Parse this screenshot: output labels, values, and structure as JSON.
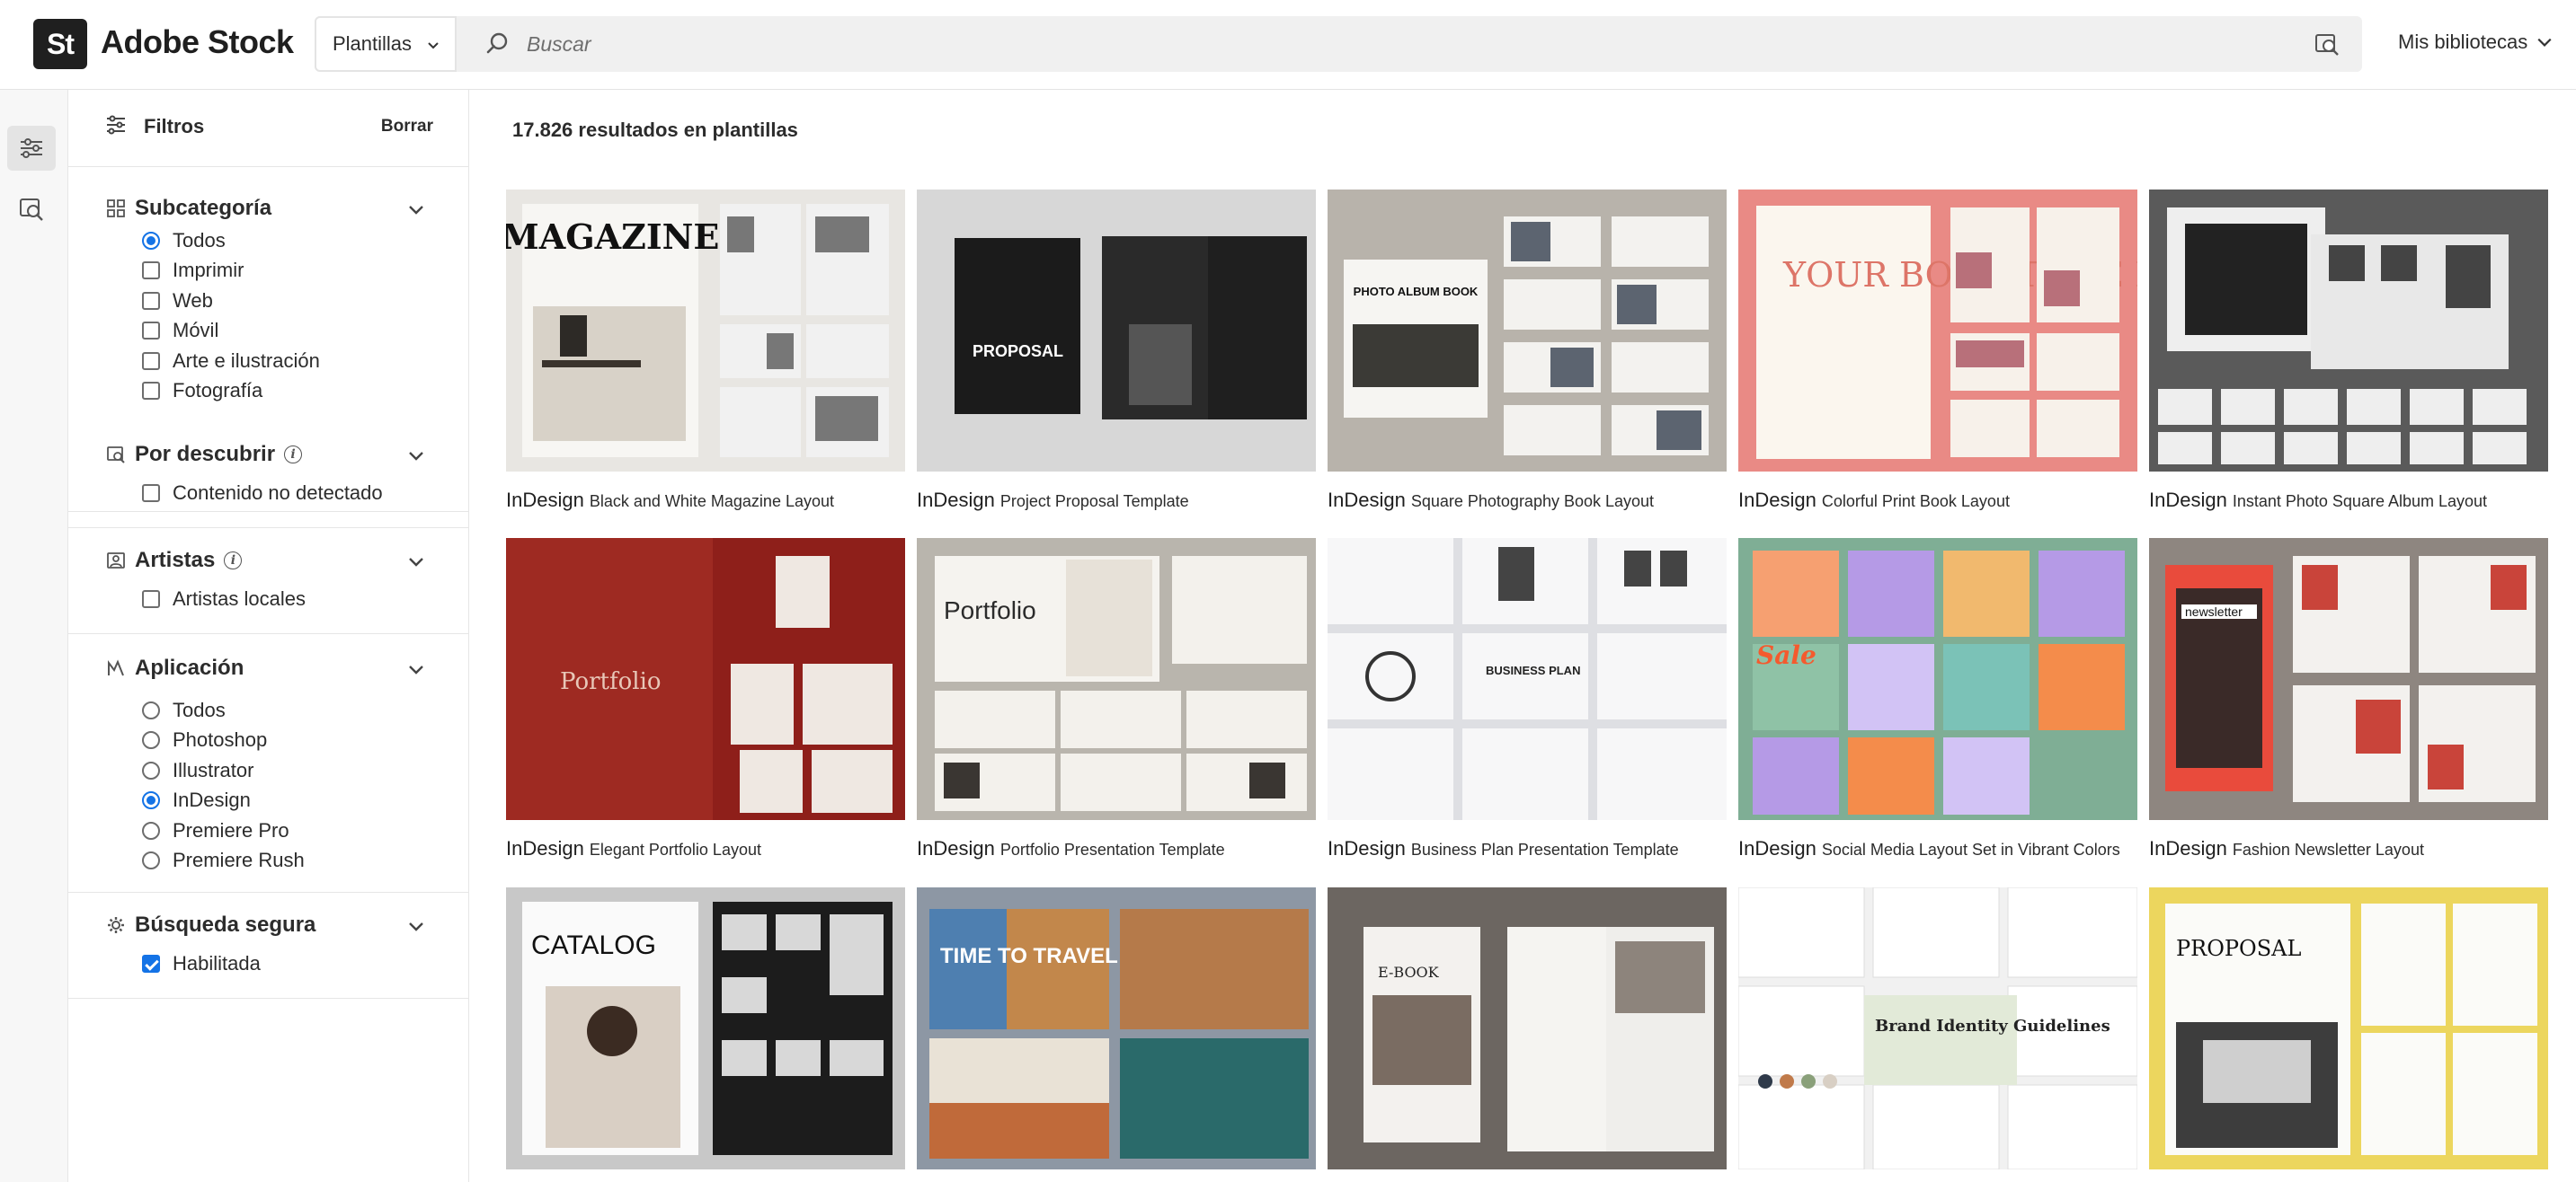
{
  "header": {
    "logo_text": "St",
    "brand": "Adobe Stock",
    "type_select": "Plantillas",
    "search_placeholder": "Buscar",
    "libraries": "Mis bibliotecas"
  },
  "rail": {
    "items": [
      "filters-toggle-icon",
      "visual-search-icon"
    ]
  },
  "filters": {
    "title": "Filtros",
    "clear": "Borrar",
    "sections": [
      {
        "title": "Subcategoría",
        "icon": "grid-icon",
        "info": false,
        "type": "radio",
        "options": [
          {
            "label": "Todos",
            "selected": true
          },
          {
            "label": "Imprimir",
            "selected": false
          },
          {
            "label": "Web",
            "selected": false
          },
          {
            "label": "Móvil",
            "selected": false
          },
          {
            "label": "Arte e ilustración",
            "selected": false
          },
          {
            "label": "Fotografía",
            "selected": false
          }
        ]
      },
      {
        "title": "Por descubrir",
        "icon": "discover-icon",
        "info": true,
        "type": "checkbox",
        "options": [
          {
            "label": "Contenido no detectado",
            "selected": false
          }
        ]
      },
      {
        "title": "Artistas",
        "icon": "artist-icon",
        "info": true,
        "type": "checkbox",
        "options": [
          {
            "label": "Artistas locales",
            "selected": false
          }
        ]
      },
      {
        "title": "Aplicación",
        "icon": "app-icon",
        "info": false,
        "type": "radio",
        "options": [
          {
            "label": "Todos",
            "selected": false
          },
          {
            "label": "Photoshop",
            "selected": false
          },
          {
            "label": "Illustrator",
            "selected": false
          },
          {
            "label": "InDesign",
            "selected": true
          },
          {
            "label": "Premiere Pro",
            "selected": false
          },
          {
            "label": "Premiere Rush",
            "selected": false
          }
        ]
      },
      {
        "title": "Búsqueda segura",
        "icon": "gear-icon",
        "info": false,
        "type": "checkbox",
        "options": [
          {
            "label": "Habilitada",
            "selected": true
          }
        ]
      }
    ]
  },
  "main": {
    "results": "17.826 resultados en plantillas",
    "cards": [
      {
        "app": "InDesign",
        "title": "Black and White Magazine Layout",
        "thumb_text": "MAGAZINE",
        "bg": "#e8e6e2"
      },
      {
        "app": "InDesign",
        "title": "Project Proposal Template",
        "thumb_text": "PROPOSAL",
        "bg": "#d7d7d7"
      },
      {
        "app": "InDesign",
        "title": "Square Photography Book Layout",
        "thumb_text": "PHOTO ALBUM BOOK",
        "bg": "#b8b3ab"
      },
      {
        "app": "InDesign",
        "title": "Colorful Print Book Layout",
        "thumb_text": "YOUR BOOK TITLE HERE",
        "bg": "#e98a85"
      },
      {
        "app": "InDesign",
        "title": "Instant Photo Square Album Layout",
        "thumb_text": "",
        "bg": "#5a5a5a"
      },
      {
        "app": "InDesign",
        "title": "Elegant Portfolio Layout",
        "thumb_text": "Portfolio",
        "bg": "#8e1f1a"
      },
      {
        "app": "InDesign",
        "title": "Portfolio Presentation Template",
        "thumb_text": "Portfolio",
        "bg": "#b9b5ad"
      },
      {
        "app": "InDesign",
        "title": "Business Plan Presentation Template",
        "thumb_text": "BUSINESS PLAN",
        "bg": "#dedfe3"
      },
      {
        "app": "InDesign",
        "title": "Social Media Layout Set in Vibrant Colors",
        "thumb_text": "Sale",
        "bg": "#7fae95"
      },
      {
        "app": "InDesign",
        "title": "Fashion Newsletter Layout",
        "thumb_text": "newsletter",
        "bg": "#8e8680"
      },
      {
        "app": "",
        "title": "",
        "thumb_text": "CATALOG",
        "bg": "#c8c8c8"
      },
      {
        "app": "",
        "title": "",
        "thumb_text": "TIME TO TRAVEL",
        "bg": "#8d97a4"
      },
      {
        "app": "",
        "title": "",
        "thumb_text": "E-BOOK",
        "bg": "#6c6661"
      },
      {
        "app": "",
        "title": "",
        "thumb_text": "Brand Identity Guidelines",
        "bg": "#f1f1f1"
      },
      {
        "app": "",
        "title": "",
        "thumb_text": "PROPOSAL",
        "bg": "#ecd65e"
      }
    ]
  }
}
